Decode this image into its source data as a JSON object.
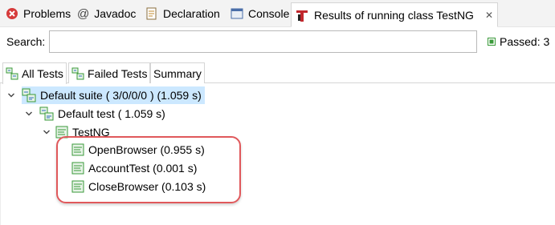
{
  "view_tabs": [
    {
      "label": "Problems"
    },
    {
      "label": "Javadoc"
    },
    {
      "label": "Declaration"
    },
    {
      "label": "Console"
    },
    {
      "label": "Results of running class TestNG"
    }
  ],
  "search": {
    "label": "Search:",
    "value": ""
  },
  "status": {
    "passed": "Passed: 3"
  },
  "sub_tabs": [
    {
      "label": "All Tests"
    },
    {
      "label": "Failed Tests"
    },
    {
      "label": "Summary"
    }
  ],
  "tree": {
    "suite": "Default suite ( 3/0/0/0 ) (1.059 s)",
    "test": "Default test ( 1.059 s)",
    "class": "TestNG",
    "methods": [
      {
        "name": "OpenBrowser  (0.955 s)"
      },
      {
        "name": "AccountTest  (0.001 s)"
      },
      {
        "name": "CloseBrowser  (0.103 s)"
      }
    ]
  },
  "colors": {
    "selection": "#cce8ff",
    "highlight": "#e0585b",
    "pass": "#3a9a3a"
  }
}
